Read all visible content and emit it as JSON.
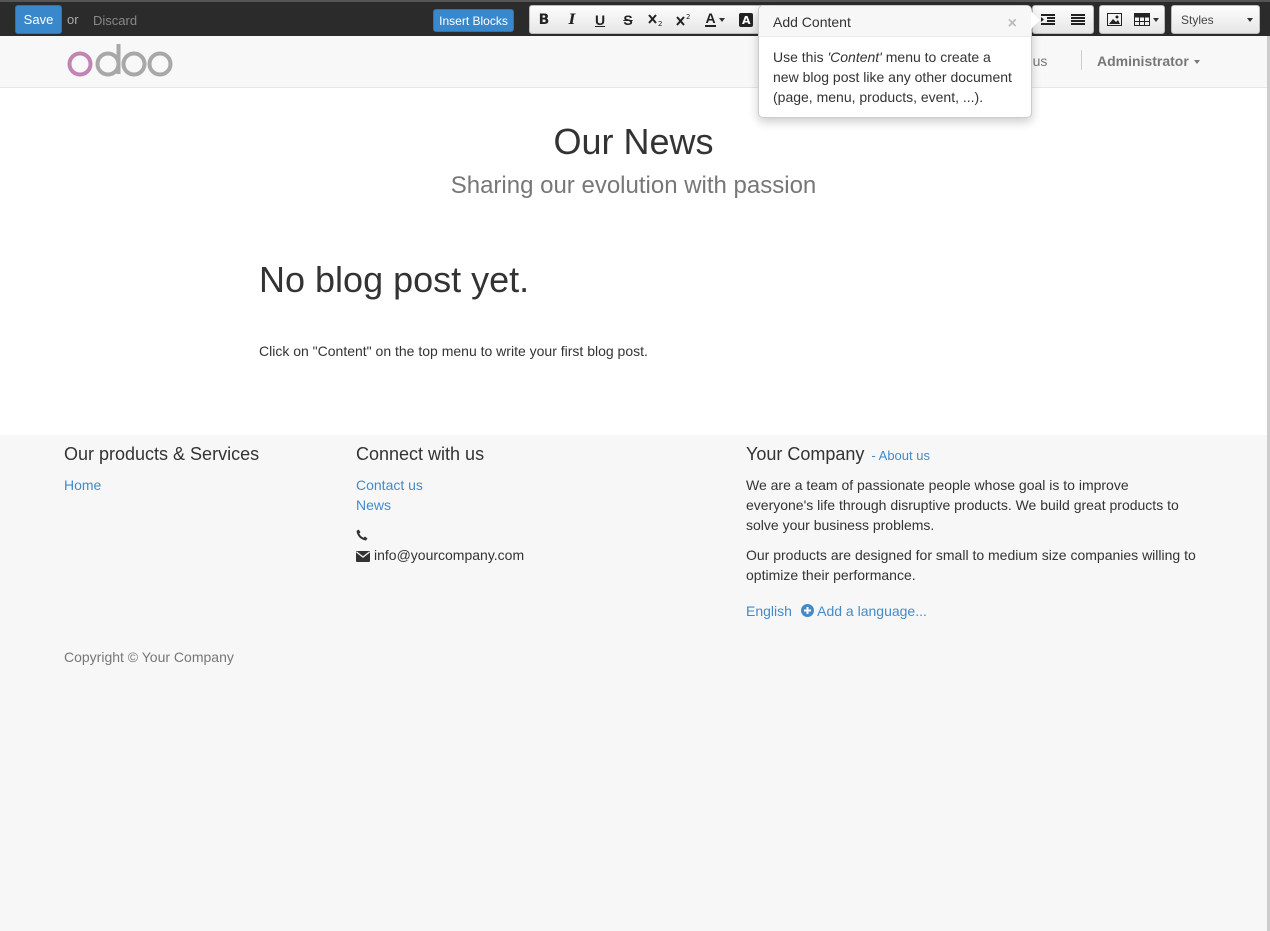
{
  "toolbar": {
    "save_label": "Save",
    "or_label": "or",
    "discard_label": "Discard",
    "insert_blocks_label": "Insert Blocks",
    "bold": "B",
    "italic": "I",
    "underline": "U",
    "strike": "S",
    "font_color": "A",
    "styles_label": "Styles"
  },
  "header": {
    "logo_text": "odoo",
    "nav_contact": "act us",
    "nav_admin": "Administrator"
  },
  "main": {
    "title": "Our News",
    "subtitle": "Sharing our evolution with passion",
    "empty_title": "No blog post yet.",
    "empty_text": "Click on \"Content\" on the top menu to write your first blog post."
  },
  "footer": {
    "col1": {
      "heading": "Our products & Services",
      "links": [
        "Home"
      ]
    },
    "col2": {
      "heading": "Connect with us",
      "links": [
        "Contact us",
        "News"
      ],
      "email": "info@yourcompany.com"
    },
    "col3": {
      "heading": "Your Company",
      "about_link": "- About us",
      "para1": "We are a team of passionate people whose goal is to improve everyone's life through disruptive products. We build great products to solve your business problems.",
      "para2": "Our products are designed for small to medium size companies willing to optimize their performance.",
      "lang_current": "English",
      "lang_add": "Add a language..."
    },
    "copyright": "Copyright © Your Company"
  },
  "popover": {
    "title": "Add Content",
    "close": "×",
    "text_before": "Use this ",
    "text_em": "'Content'",
    "text_after": " menu to create a new blog post like any other document (page, menu, products, event, ...)."
  },
  "colors": {
    "primary": "#3a88cc",
    "link": "#428bca",
    "toolbar_bg": "#2b2b2b",
    "logo_o": "#c284b5",
    "logo_rest": "#a8a8a8"
  }
}
